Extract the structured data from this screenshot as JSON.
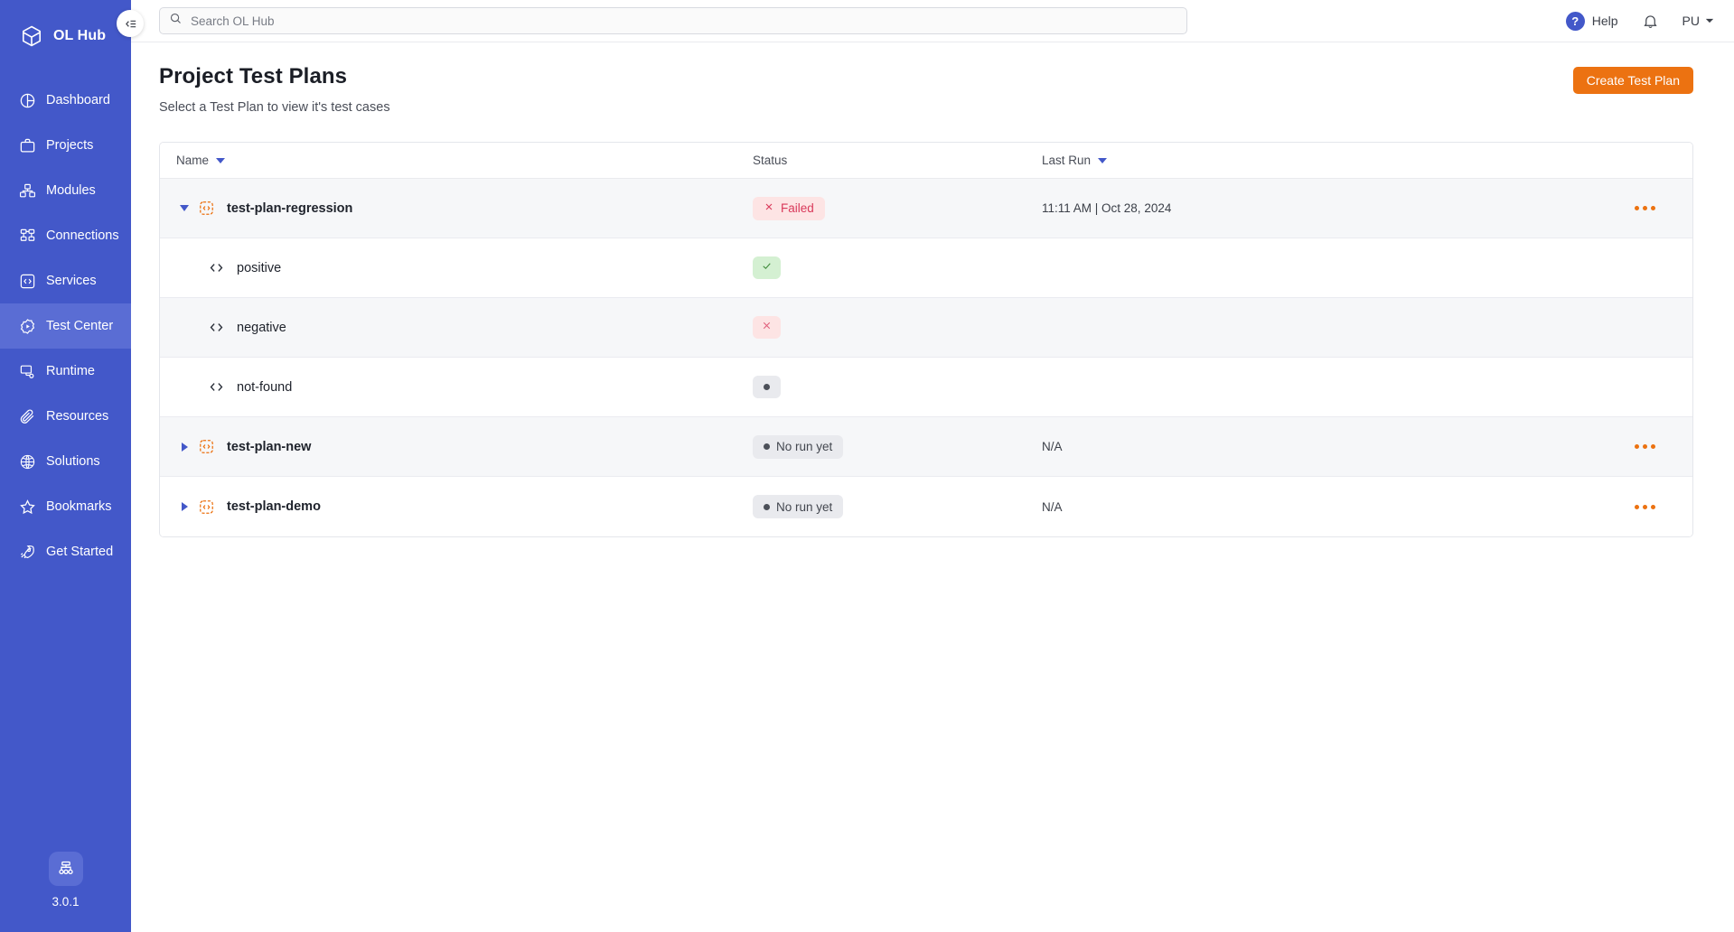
{
  "brand": {
    "name": "OL Hub",
    "logo_icon": "hexagon-logo-icon"
  },
  "sidebar": {
    "collapse_icon": "collapse-sidebar-icon",
    "items": [
      {
        "label": "Dashboard",
        "icon": "pie-chart-icon",
        "active": false
      },
      {
        "label": "Projects",
        "icon": "briefcase-icon",
        "active": false
      },
      {
        "label": "Modules",
        "icon": "modules-icon",
        "active": false
      },
      {
        "label": "Connections",
        "icon": "nodes-icon",
        "active": false
      },
      {
        "label": "Services",
        "icon": "code-box-icon",
        "active": false
      },
      {
        "label": "Test Center",
        "icon": "play-gear-icon",
        "active": true
      },
      {
        "label": "Runtime",
        "icon": "runtime-icon",
        "active": false
      },
      {
        "label": "Resources",
        "icon": "paperclip-icon",
        "active": false
      },
      {
        "label": "Solutions",
        "icon": "globe-icon",
        "active": false
      },
      {
        "label": "Bookmarks",
        "icon": "star-icon",
        "active": false
      },
      {
        "label": "Get Started",
        "icon": "rocket-icon",
        "active": false
      }
    ],
    "footer": {
      "icon": "sitemap-icon",
      "version": "3.0.1"
    }
  },
  "topbar": {
    "search": {
      "icon": "search-icon",
      "value": "",
      "placeholder": "Search OL Hub"
    },
    "help": {
      "icon": "question-mark-icon",
      "label": "Help"
    },
    "notifications_icon": "bell-icon",
    "user": {
      "initials": "PU",
      "chevron_icon": "chevron-down-icon"
    }
  },
  "page": {
    "title": "Project Test Plans",
    "subtitle": "Select a Test Plan to view it's test cases",
    "create_button": "Create Test Plan"
  },
  "table": {
    "columns": [
      {
        "label": "Name",
        "sortable": true,
        "sort_icon": "caret-down-icon"
      },
      {
        "label": "Status",
        "sortable": false,
        "sort_icon": ""
      },
      {
        "label": "Last Run",
        "sortable": true,
        "sort_icon": "caret-down-icon"
      }
    ],
    "rows": [
      {
        "type": "plan",
        "name": "test-plan-regression",
        "icon": "test-plan-icon",
        "expander_icon": "triangle-down-icon",
        "expanded": true,
        "status": {
          "kind": "badge",
          "label": "Failed",
          "icon": "x-icon",
          "style": "failed"
        },
        "last_run": "11:11 AM | Oct 28, 2024",
        "actions_icon": "kebab-menu-icon",
        "has_actions": true,
        "shaded": true
      },
      {
        "type": "case",
        "name": "positive",
        "icon": "code-icon",
        "expander_icon": "",
        "status": {
          "kind": "mini",
          "label": "",
          "icon": "check-icon",
          "style": "pass"
        },
        "last_run": "",
        "actions_icon": "",
        "has_actions": false,
        "shaded": false
      },
      {
        "type": "case",
        "name": "negative",
        "icon": "code-icon",
        "expander_icon": "",
        "status": {
          "kind": "mini",
          "label": "",
          "icon": "x-icon",
          "style": "fail"
        },
        "last_run": "",
        "actions_icon": "",
        "has_actions": false,
        "shaded": true
      },
      {
        "type": "case",
        "name": "not-found",
        "icon": "code-icon",
        "expander_icon": "",
        "status": {
          "kind": "mini",
          "label": "",
          "icon": "dot-icon",
          "style": "none"
        },
        "last_run": "",
        "actions_icon": "",
        "has_actions": false,
        "shaded": false
      },
      {
        "type": "plan",
        "name": "test-plan-new",
        "icon": "test-plan-icon",
        "expander_icon": "triangle-right-icon",
        "expanded": false,
        "status": {
          "kind": "badge",
          "label": "No run yet",
          "icon": "dot-icon",
          "style": "norun"
        },
        "last_run": "N/A",
        "actions_icon": "kebab-menu-icon",
        "has_actions": true,
        "shaded": true
      },
      {
        "type": "plan",
        "name": "test-plan-demo",
        "icon": "test-plan-icon",
        "expander_icon": "triangle-right-icon",
        "expanded": false,
        "status": {
          "kind": "badge",
          "label": "No run yet",
          "icon": "dot-icon",
          "style": "norun"
        },
        "last_run": "N/A",
        "actions_icon": "kebab-menu-icon",
        "has_actions": true,
        "shaded": false
      }
    ]
  },
  "colors": {
    "sidebar_bg": "#4358c9",
    "sidebar_active": "#5a6dd4",
    "accent_orange": "#ec7211",
    "status_failed_bg": "#fde4e4",
    "status_failed_fg": "#d9395a",
    "status_pass_bg": "#d4f0d2",
    "status_none_bg": "#e9eaee"
  }
}
